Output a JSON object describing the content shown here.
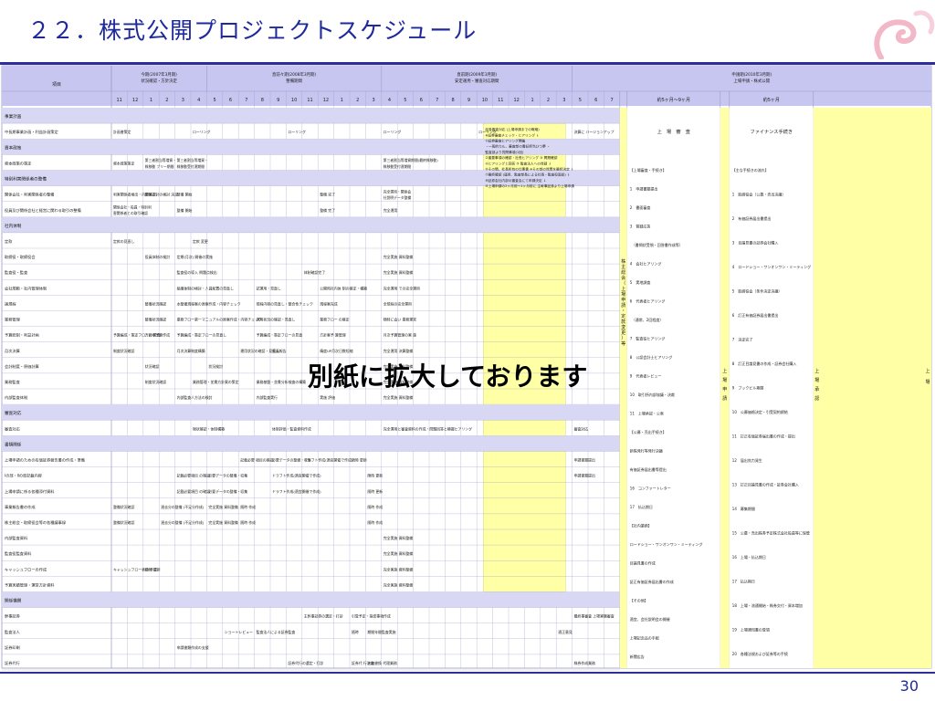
{
  "slide": {
    "title": "２２．株式公開プロジェクトスケジュール",
    "page_number": "30",
    "overlay_text": "別紙に拡大しております"
  },
  "colors": {
    "header_bg": "#c6c6f0",
    "grid_line": "#9a9ac8",
    "group_bg": "#d8d8f4",
    "yellow": "#ffffa6",
    "title_blue": "#1f2a9a",
    "rule": "#2e2e9a"
  },
  "schedule": {
    "item_header": "項目",
    "phases": [
      {
        "line1": "今期(2007年3月期)",
        "line2": "状況確認・方針決定"
      },
      {
        "line1": "直前々期(2008年3月期)",
        "line2": "整備期間"
      },
      {
        "line1": "直前期(2009年3月期)",
        "line2": "安定運用・審査対応期間"
      },
      {
        "line1": "申請期(2010年3月期)",
        "line2": "上場申請・株式公開"
      }
    ],
    "months": [
      "11",
      "12",
      "1",
      "2",
      "3",
      "4",
      "5",
      "6",
      "7",
      "8",
      "9",
      "10",
      "11",
      "12",
      "1",
      "2",
      "3",
      "4",
      "5",
      "6",
      "7",
      "8",
      "9",
      "10",
      "11",
      "12",
      "1",
      "2",
      "3",
      "5",
      "6",
      "7"
    ],
    "period_labels": [
      "約5ヶ月～9ヶ月",
      "約5ヶ月"
    ],
    "rows": [
      {
        "label": "事業計画",
        "group": true
      },
      {
        "label": "中長期事業計画・利益計画策定",
        "cells": {
          "0": "計画書策定",
          "5": "ローリング",
          "11": "ローリング",
          "17": "ローリング",
          "23": "ローリング",
          "29": "決算に バージョンアップ"
        }
      },
      {
        "label": "資本政策",
        "group": true
      },
      {
        "label": "資本政策の策定",
        "cells": {
          "0": "資本政策策定",
          "2": "第三者割当等増資・ 株移動 プリー期間",
          "4": "第三者割当等増資・ 株移動受付運期間",
          "17": "第三者割当等増資期間(最終株移動) 株移動受付運期間"
        }
      },
      {
        "label": "特別利害関係者の整備",
        "group": true
      },
      {
        "label": "関係会社・利害関係者の整備",
        "cells": {
          "0": "利害関係者検出・内部確認",
          "2": "関係方針の検討 決定",
          "4": "整備 開始",
          "13": "整備 完了",
          "17": "完全運用・関係会 社説明データ整備"
        }
      },
      {
        "label": "役員及び関係会社と経営に関わる取引の整備",
        "cells": {
          "0": "関係会社・役員・特別利 害関係者との取引確認",
          "4": "整備 開始",
          "13": "整備 完了",
          "17": "完全運用"
        }
      },
      {
        "label": "社内体制",
        "group": true
      },
      {
        "label": "定款",
        "cells": {
          "0": "定款の見直し",
          "5": "定款 変更"
        }
      },
      {
        "label": "取締役・取締役会",
        "cells": {
          "2": "役員体制の検討",
          "4": "定期(月次) 開催の実施",
          "17": "完全実施 資料整備"
        }
      },
      {
        "label": "監査役・監査",
        "cells": {
          "4": "監査役の導入 問題点検出",
          "12": "体制確認完了",
          "17": "完全実施 資料整備"
        }
      },
      {
        "label": "会社規範・社内管理体制",
        "cells": {
          "4": "組織体制の検討・人員配置の見直し",
          "9": "試運用・見直し",
          "13": "公開時社内体 制の確定・構築",
          "17": "完全運用 での完全運用"
        }
      },
      {
        "label": "諸規程",
        "cells": {
          "2": "整備状況確認",
          "4": "本整備規程案の原案作成・内容チェック",
          "9": "規程内容の見直し・整合性チェック",
          "13": "規程案完成",
          "17": "全規程の完全運用"
        }
      },
      {
        "label": "業務管理",
        "cells": {
          "2": "整備状況確認",
          "4": "業務フロー第一マニュアルの原案作成・内容チェック",
          "9": "運用状況の確認・見直し",
          "13": "業務フロー の確定",
          "17": "随時に会い 業務運営"
        }
      },
      {
        "label": "予算統制・利益計画",
        "cells": {
          "0": "予算編成・策定フローの 見直",
          "2": "方針案予算作成",
          "4": "予算編成・策定フローの見直し",
          "9": "予算編成・策定フローの見直",
          "13": "方針案予 算管理",
          "17": "月次予算管理の実 施"
        }
      },
      {
        "label": "月次決算",
        "cells": {
          "0": "制度状況確認",
          "4": "月次決算制度構築",
          "8": "運用状況の確認・見直し",
          "10": "役員報告",
          "13": "精度UP月次日数短縮",
          "17": "完全運用 決算整備"
        }
      },
      {
        "label": "会計制度・原価計算",
        "cells": {
          "2": "状況確認",
          "6": "状況検討",
          "17": "完全実施 資料整備"
        }
      },
      {
        "label": "業務監査",
        "cells": {
          "2": "制度状況確認",
          "5": "業務管理・並貫方針案の策定",
          "9": "業務基盤・並貫分析検査の構築",
          "17": "完全実施 資料整備"
        }
      },
      {
        "label": "内部監査体制",
        "cells": {
          "4": "内部監査人方法の検討",
          "9": "内部監査実行",
          "13": "実施 評価",
          "17": "完全実施 資料整備"
        }
      },
      {
        "label": "審査対応",
        "group": true
      },
      {
        "label": "審査対応",
        "cells": {
          "5": "現状確認・体制構築",
          "10": "体制評価・監査資料作成",
          "17": "完全運用と審査資料の作成・問題回答と模擬ヒアリング",
          "29": "審査対応"
        }
      },
      {
        "label": "書類関係",
        "group": true
      },
      {
        "label": "上場申請のための有価証券報告書の作成・準備",
        "cells": {
          "8": "記載必要 項目の確認",
          "10": "必要データの整備・収集",
          "12": "ドラフト作成(適宜開催で作成)",
          "15": "随時 更新",
          "29": "申請書類提出"
        }
      },
      {
        "label": "Ⅰの部・Ⅱの部記載内容",
        "cells": {
          "4": "記載必要項目 の確認",
          "6": "必要データの整備・収集",
          "10": "ドラフト作成(適宜開催で作成)",
          "16": "随時 更新",
          "29": "申請書類提出"
        }
      },
      {
        "label": "上場申請に係る各種添付資料",
        "cells": {
          "4": "記載必要項目 の確認",
          "6": "必要データの整備・収集",
          "10": "ドラフト作成(適宜開催で作成)",
          "16": "随時 更新"
        }
      },
      {
        "label": "事業報告書の作成",
        "cells": {
          "0": "整備状況確認",
          "3": "過去分の整備 (不足分作成)",
          "6": "完全実施 資料整備",
          "8": "随時 作成",
          "16": "随時 作成"
        }
      },
      {
        "label": "株主総会・取締役会等の各種議事録",
        "cells": {
          "0": "整備状況確認",
          "3": "過去分の整備 (不足分作成)",
          "6": "完全実施 資料整備",
          "8": "随時 作成",
          "16": "随時 作成"
        }
      },
      {
        "label": "内部監査資料",
        "cells": {
          "17": "完全実施 資料整備"
        }
      },
      {
        "label": "監査役監査資料",
        "cells": {
          "17": "完全実施 資料整備"
        }
      },
      {
        "label": "キャッシュフローの作成",
        "cells": {
          "0": "キャッシュフロー表の 作成",
          "2": "随時 更新",
          "17": "完全実施 資料整備"
        }
      },
      {
        "label": "予算実績管理・運営方針資料",
        "cells": {
          "17": "完全実施 資料整備"
        }
      },
      {
        "label": "関係機関",
        "group": true
      },
      {
        "label": "幹事証券",
        "cells": {
          "12": "主幹事証券の選定・打診",
          "15": "引受予定・指導事項作成",
          "29": "最終事審査 上場実験審査"
        }
      },
      {
        "label": "監査法人",
        "cells": {
          "7": "ショートレビュー",
          "9": "監査法人による証券監査",
          "15": "随時",
          "16": "期間年間監査実施",
          "28": "適正意見"
        }
      },
      {
        "label": "証券印刷",
        "cells": {
          "4": "申請書類作成の支援"
        }
      },
      {
        "label": "証券代行",
        "cells": {
          "11": "証券代行の選定・打診",
          "15": "証券代 行決定",
          "16": "名義書換 代理業務",
          "29": "株券作成業務"
        }
      }
    ],
    "listing_box": {
      "text": "証券審査対応 (上場申請までの概略) ※証券審査チェック・ヒアリング ↓ ①証券審査ヒアリング開催 ・一般的カル、審査部の書記担当ひつ夢 ・ 監査部より質問事項(1回) ②重要事項の確認・社長ヒアリング ③ 問題確認 ④ヒアリングと回答 ⑤ 監査法人への質疑 ↓ ⑥その間、社長所有の仕事書 ※その部の質問を最終決定 ↓ ⑦最終確認 (運用、監査部長による社長・監査役面談) ↓ ⑧証券会社内部の審査会にて申請決定 ↓ ⑨上場申請の2ヶ月前～1ヶ月前に 主幹事証券より上場申請"
    },
    "vertical_col1": "株主総会（上場申請・定款変更）等",
    "vertical_col2": "上 場 申 請",
    "vertical_col3": "上 場 承 認",
    "vertical_col4": "上 場",
    "exam_header": "上　場　審　査",
    "finance_header": "ファイナンス手続き",
    "exam_list": [
      "【上場審査・手続き】",
      "1　申請書類提出",
      "2　書面審査",
      "3　質疑応答",
      "　（書問状受領・回答書作成等）",
      "4　会社ヒアリング",
      "5　実地調査",
      "6　代表者ヒアリング",
      "　（通常、2回程度）",
      "7　監査役ヒアリング",
      "8　公認会計士ヒアリング",
      "9　代表者レビュー",
      "10　取引所内部協議・決裁",
      "11　上場承認・公表",
      "【公募・売出手続き】",
      "新株発行等発行決議",
      "有価証券届出書等提出",
      "16　コンファートレター",
      "17　払込期日",
      "【社内業務】",
      "ロードショー・ワンオンワン・ミーティング",
      "目論見書の作成",
      "証正有価証券届出書の作成",
      "【その他】",
      "適宜、会社説明会の開催",
      "上場記念品の手配",
      "新聞広告"
    ],
    "finance_list": [
      "【主な手続きの流れ】",
      "1　取締役会（公募・売出決議）",
      "2　有価証券届出書提出",
      "3　目論見書の証券会社購入",
      "4　ロードショー・ワンオンワン・ミーティング",
      "5　取締役会（条件決定決議）",
      "6　訂正有価証券届出書提出",
      "7　決定完了",
      "8　訂正目論見書の作成・証券会社購入",
      "9　ブックビル期間",
      "10　公募価格決定・引受契約締結",
      "11　訂正有価証券届出書の作成・提出",
      "12　届出効力発生",
      "13　訂正目論見書の作成・証券会社購入",
      "14　募集期間",
      "15　公募・売出株券予定株式会社役員等に保管",
      "16　上場・払込期日",
      "17　払込期日",
      "18　上場・流通開始・株券交付・資本増加",
      "19　上場通知書の受領",
      "20　各種法規および証券等の手続"
    ]
  }
}
